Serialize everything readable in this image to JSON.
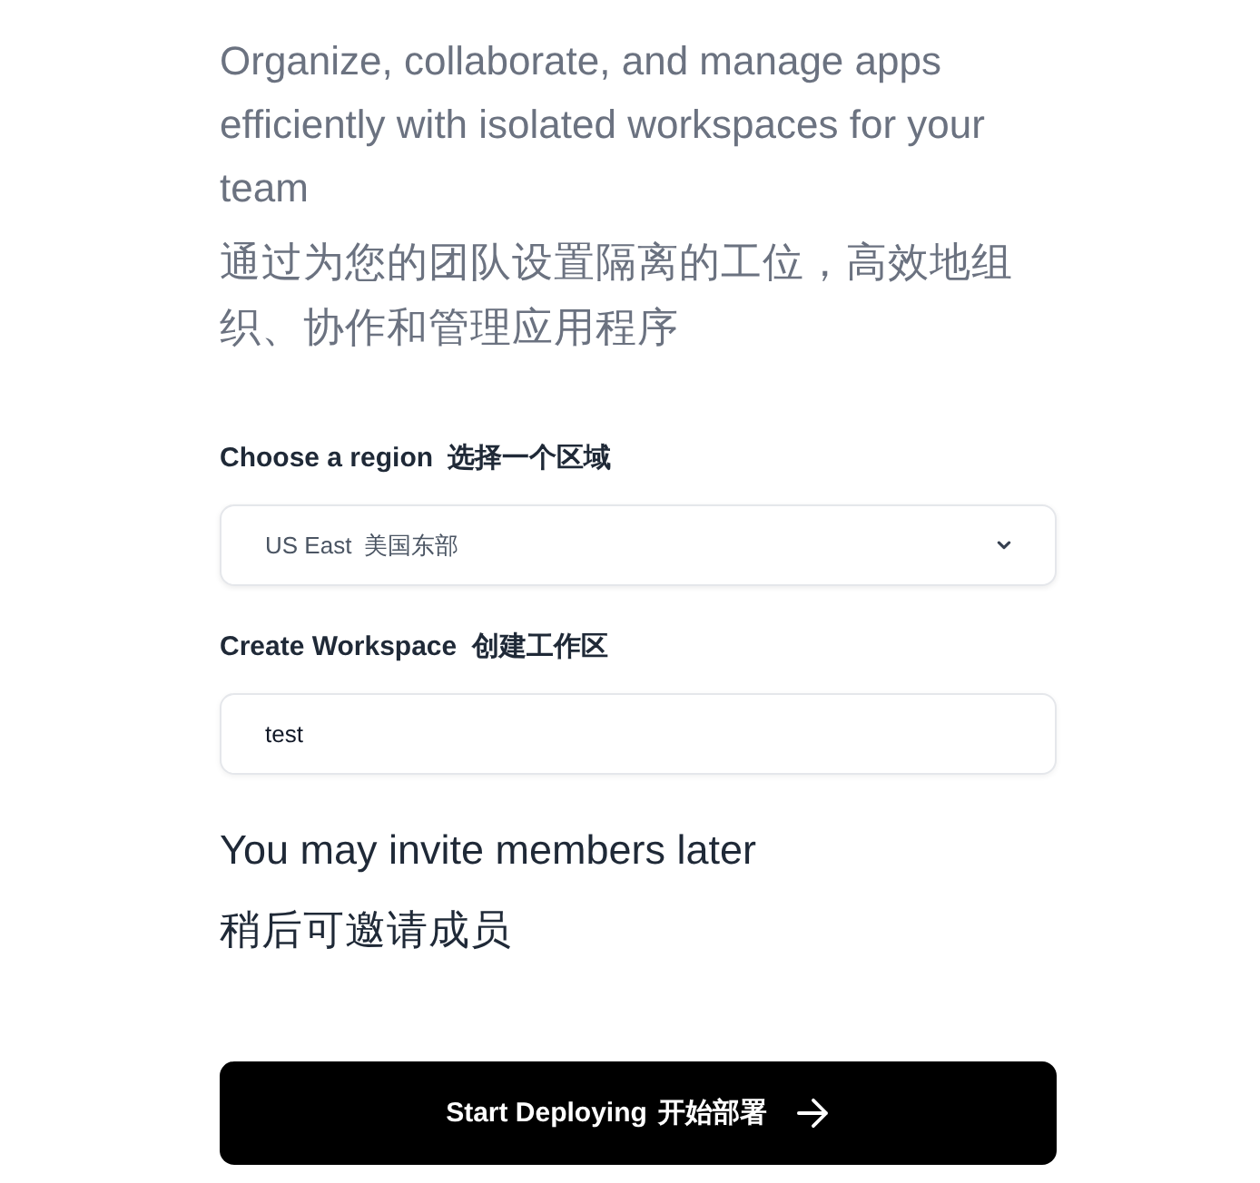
{
  "description": {
    "english": "Organize, collaborate, and manage apps efficiently with isolated workspaces for your team",
    "chinese": "通过为您的团队设置隔离的工位，高效地组织、协作和管理应用程序"
  },
  "region": {
    "label": "Choose a region",
    "label_zh": "选择一个区域",
    "value": "US East",
    "value_zh": "美国东部"
  },
  "workspace": {
    "label": "Create Workspace",
    "label_zh": "创建工作区",
    "value": "test"
  },
  "note": {
    "english": "You may invite members later",
    "chinese": "稍后可邀请成员"
  },
  "submit_button": {
    "label": "Start Deploying",
    "label_zh": "开始部署"
  }
}
